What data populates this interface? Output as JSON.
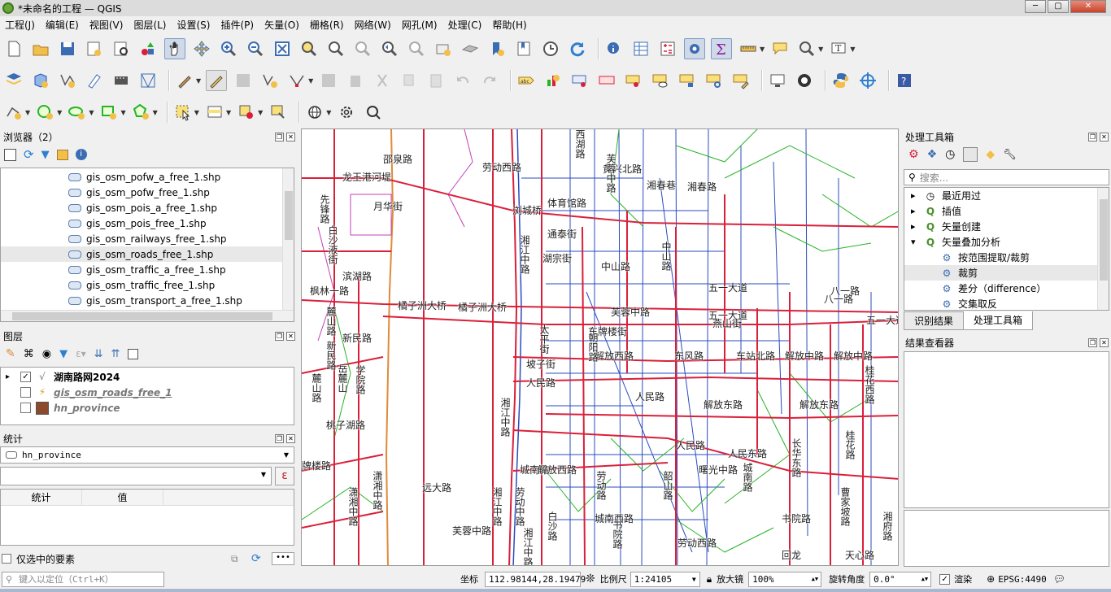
{
  "window": {
    "title": "*未命名的工程 — QGIS"
  },
  "menu": [
    "工程(J)",
    "编辑(E)",
    "视图(V)",
    "图层(L)",
    "设置(S)",
    "插件(P)",
    "矢量(O)",
    "栅格(R)",
    "网络(W)",
    "网孔(M)",
    "处理(C)",
    "帮助(H)"
  ],
  "colors": {
    "major_road": "#d9203a",
    "minor_road": "#2a4bbf",
    "path": "#27b327",
    "service": "#c43fb5",
    "rail": "#e08a3a",
    "water_edge": "#f0b060"
  },
  "browser": {
    "title": "浏览器（2）",
    "items": [
      "gis_osm_pofw_a_free_1.shp",
      "gis_osm_pofw_free_1.shp",
      "gis_osm_pois_a_free_1.shp",
      "gis_osm_pois_free_1.shp",
      "gis_osm_railways_free_1.shp",
      "gis_osm_roads_free_1.shp",
      "gis_osm_traffic_a_free_1.shp",
      "gis_osm_traffic_free_1.shp",
      "gis_osm_transport_a_free_1.shp"
    ],
    "selected_index": 5
  },
  "layers": {
    "title": "图层",
    "items": [
      {
        "name": "湖南路网2024",
        "checked": true,
        "bold": true,
        "icon": "line-layer-icon"
      },
      {
        "name": "gis_osm_roads_free_1",
        "checked": false,
        "italic": true,
        "icon": "lightning-icon"
      },
      {
        "name": "hn_province",
        "checked": false,
        "italic": true,
        "icon": "polygon-swatch-icon",
        "color": "#8b4a2b"
      }
    ]
  },
  "stats": {
    "title": "统计",
    "layer": "hn_province",
    "field": "",
    "col_stat": "统计",
    "col_value": "值",
    "selected_only": "仅选中的要素"
  },
  "toolbox": {
    "title": "处理工具箱",
    "search_placeholder": "搜索...",
    "items": [
      {
        "label": "最近用过",
        "icon": "clock-icon",
        "expand": "collapsed"
      },
      {
        "label": "插值",
        "icon": "qgis-icon",
        "expand": "collapsed"
      },
      {
        "label": "矢量创建",
        "icon": "qgis-icon",
        "expand": "collapsed"
      },
      {
        "label": "矢量叠加分析",
        "icon": "qgis-icon",
        "expand": "expanded"
      },
      {
        "label": "按范围提取/裁剪",
        "icon": "gear-icon",
        "indent": true
      },
      {
        "label": "裁剪",
        "icon": "gear-icon",
        "indent": true,
        "selected": true
      },
      {
        "label": "差分（difference）",
        "icon": "gear-icon",
        "indent": true
      },
      {
        "label": "交集取反",
        "icon": "gear-icon",
        "indent": true
      }
    ],
    "tabs": [
      "识别结果",
      "处理工具箱"
    ],
    "active_tab": 1
  },
  "results": {
    "title": "结果查看器"
  },
  "statusbar": {
    "search_placeholder": "键入以定位（Ctrl+K）",
    "coord_label": "坐标",
    "coord": "112.98144,28.19479",
    "scale_label": "比例尺",
    "scale": "1:24105",
    "magnifier_label": "放大镜",
    "magnifier": "100%",
    "rotation_label": "旋转角度",
    "rotation": "0.0°",
    "render_label": "渲染",
    "crs": "EPSG:4490"
  },
  "map_labels": [
    "邵泉路",
    "龙王港河堤",
    "月华街",
    "先锋路",
    "白沙液街",
    "滨湖路",
    "枫林一路",
    "新民路",
    "麓山路",
    "新民路",
    "麓山路",
    "岳麓山",
    "学院路",
    "桃子湖路",
    "牌楼路",
    "潇湘中路",
    "潇湘中路",
    "橘子洲大桥",
    "橘子洲大桥",
    "湘江中路",
    "湘江中路",
    "湘江中路",
    "湘江中路",
    "太平街",
    "坡子街",
    "人民路",
    "东牌楼街",
    "解放西路",
    "西湖路",
    "黄兴北路",
    "湘春巷",
    "湘春路",
    "体育馆路",
    "通泰街",
    "湖宗街",
    "中山路",
    "中山路",
    "芙蓉中路",
    "芙蓉中路",
    "五一大道",
    "五一大道",
    "五一大道",
    "八一路",
    "八一路",
    "燕山街",
    "东风路",
    "车站北路",
    "解放中路",
    "解放中路",
    "解放东路",
    "解放东路",
    "人民路",
    "人民路",
    "人民东路",
    "城南路",
    "城南路",
    "城南西路",
    "劳动西路",
    "劳动路",
    "劳动中路",
    "白沙路",
    "书院路",
    "书院路",
    "回龙",
    "天心路",
    "曹家坡路",
    "桂花西路",
    "桂花路",
    "长华东路",
    "朝阳路",
    "曙光中路",
    "韶山路",
    "解放西路",
    "湘府路",
    "远大路",
    "芙蓉中路",
    "劳动西路",
    "浏城桥"
  ]
}
